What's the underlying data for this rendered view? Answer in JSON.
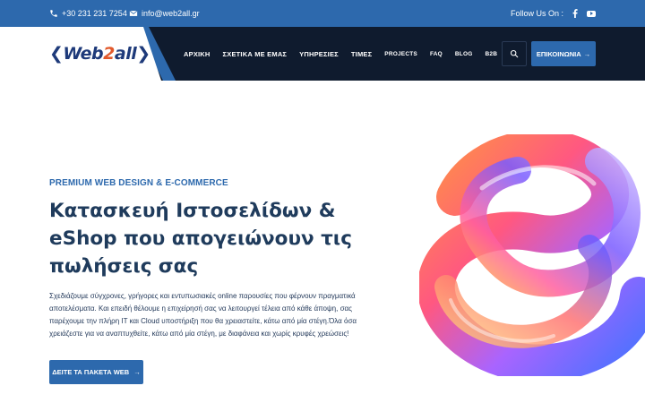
{
  "topbar": {
    "phone": "+30 231 231 7254",
    "email": "info@web2all.gr",
    "follow_label": "Follow Us On :",
    "social_icons": [
      "facebook-icon",
      "youtube-icon"
    ]
  },
  "logo": {
    "left_chevron": "❮",
    "part1": "Web",
    "part2": "2",
    "part3": "all",
    "right_chevron": "❯"
  },
  "nav": {
    "items": [
      {
        "label": "ΑΡΧΙΚΗ"
      },
      {
        "label": "ΣΧΕΤΙΚΑ ΜΕ ΕΜΑΣ"
      },
      {
        "label": "ΥΠΗΡΕΣΙΕΣ"
      },
      {
        "label": "ΤΙΜΕΣ"
      },
      {
        "label": "PROJECTS"
      },
      {
        "label": "FAQ"
      },
      {
        "label": "BLOG"
      },
      {
        "label": "B2B"
      }
    ],
    "cta_label": "ΕΠΙΚΟΙΝΩΝΙΑ",
    "cta_arrow": "→"
  },
  "hero": {
    "eyebrow": "PREMIUM WEB DESIGN & E-COMMERCE",
    "title": "Κατασκευή Ιστοσελίδων & eShop που απογειώνουν τις πωλήσεις σας",
    "text": "Σχεδιάζουμε σύγχρονες, γρήγορες και εντυπωσιακές online παρουσίες που φέρνουν πραγματικά αποτελέσματα. Και επειδή θέλουμε η επιχείρησή σας να λειτουργεί τέλεια από κάθε άποψη, σας παρέχουμε την πλήρη IT και Cloud υποστήριξη που θα χρειαστείτε, κάτω από μία στέγη.Όλα όσα χρειάζεστε για να αναπτυχθείτε, κάτω από μία στέγη, με διαφάνεια και χωρίς κρυφές χρεώσεις!",
    "button_label": "ΔΕΙΤΕ ΤΑ ΠΑΚΕΤΑ WEB",
    "button_arrow": "→"
  },
  "colors": {
    "brand_blue": "#2d69ad",
    "header_dark": "#0f1b2e",
    "title": "#1f3b5c",
    "logo_accent": "#e25a2c"
  }
}
